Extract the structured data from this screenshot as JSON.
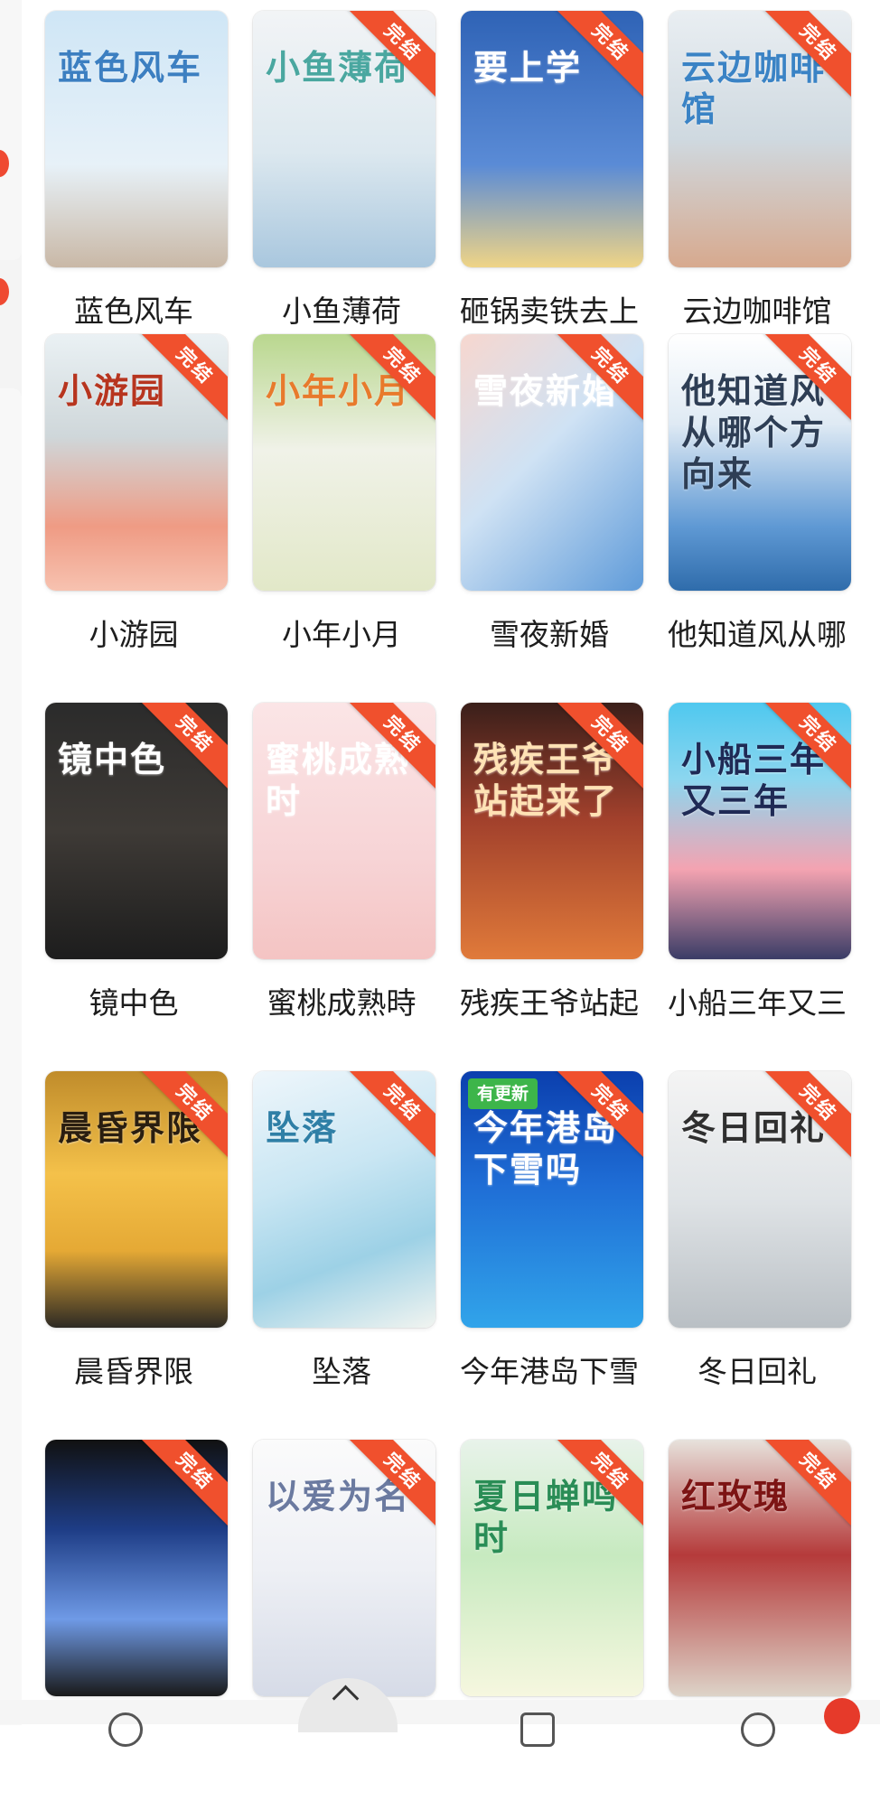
{
  "ribbon_label": "完结",
  "update_label": "有更新",
  "colors": {
    "ribbon": "#f0502d",
    "update_badge": "#3db54a",
    "badge_dot": "#e63a2a"
  },
  "books": [
    {
      "title": "蓝色风车",
      "cover_text": "蓝色风车",
      "bg": "linear-gradient(180deg,#cfe6f6 0%,#e7f1f8 60%,#c9b8a6 100%)",
      "fg": "#3c7fc1",
      "ribbon": false,
      "update": false
    },
    {
      "title": "小鱼薄荷",
      "cover_text": "小鱼薄荷",
      "bg": "linear-gradient(180deg,#f2f4f6 0%,#dce8ef 55%,#a9c7de 100%)",
      "fg": "#4aa7a0",
      "ribbon": true,
      "update": false
    },
    {
      "title": "砸锅卖铁去上",
      "cover_text": "要上学",
      "bg": "linear-gradient(180deg,#2f63b6 0%,#5a8bd6 60%,#efd486 100%)",
      "fg": "#ffffff",
      "ribbon": true,
      "update": false
    },
    {
      "title": "云边咖啡馆",
      "cover_text": "云边咖啡馆",
      "bg": "linear-gradient(180deg,#e9eef2 0%,#cfd9e0 50%,#d7a98e 100%)",
      "fg": "#3a83c5",
      "ribbon": true,
      "update": false
    },
    {
      "title": "小游园",
      "cover_text": "小游园",
      "bg": "linear-gradient(180deg,#eaf1f4 0%,#cfd7da 40%,#ef9b84 75%,#f7c2b0 100%)",
      "fg": "#b7351f",
      "ribbon": true,
      "update": false
    },
    {
      "title": "小年小月",
      "cover_text": "小年小月",
      "bg": "linear-gradient(180deg,#b9d78e 0%,#f0f2e8 45%,#e2e8c8 100%)",
      "fg": "#e87a2c",
      "ribbon": true,
      "update": false
    },
    {
      "title": "雪夜新婚",
      "cover_text": "雪夜新婚",
      "bg": "linear-gradient(135deg,#f7d7cf 0%,#cfe2f4 45%,#5f9bd9 100%)",
      "fg": "#ffffff",
      "ribbon": true,
      "update": false
    },
    {
      "title": "他知道风从哪",
      "cover_text": "他知道风从哪个方向来",
      "bg": "linear-gradient(180deg,#ffffff 0%,#dfeaf4 35%,#5f99d4 75%,#2f6cab 100%)",
      "fg": "#2e3e55",
      "ribbon": true,
      "update": false
    },
    {
      "title": "镜中色",
      "cover_text": "镜中色",
      "bg": "linear-gradient(180deg,#2b2b2b 0%,#3e3a36 50%,#1d1d1d 100%)",
      "fg": "#ffffff",
      "ribbon": true,
      "update": false
    },
    {
      "title": "蜜桃成熟時",
      "cover_text": "蜜桃成熟时",
      "bg": "linear-gradient(180deg,#fbe5e6 0%,#f7d4d6 60%,#f4c4c3 100%)",
      "fg": "#ffffff",
      "ribbon": true,
      "update": false
    },
    {
      "title": "残疾王爷站起",
      "cover_text": "残疾王爷站起来了",
      "bg": "linear-gradient(180deg,#3a1f1a 0%,#a1402c 45%,#e07a3a 100%)",
      "fg": "#ffe2b5",
      "ribbon": true,
      "update": false
    },
    {
      "title": "小船三年又三",
      "cover_text": "小船三年又三年",
      "bg": "linear-gradient(180deg,#4fc8ef 0%,#8cd6ef 30%,#f4a3b1 65%,#3a3c66 100%)",
      "fg": "#1f2a55",
      "ribbon": true,
      "update": false
    },
    {
      "title": "晨昏界限",
      "cover_text": "晨昏界限",
      "bg": "linear-gradient(180deg,#c08c2b 0%,#f4c14a 40%,#e5a935 70%,#2d2a24 100%)",
      "fg": "#2a1e10",
      "ribbon": true,
      "update": false
    },
    {
      "title": "坠落",
      "cover_text": "坠落",
      "bg": "linear-gradient(160deg,#eef6fb 0%,#c9e6f3 40%,#9dd1e6 70%,#f1f4f0 100%)",
      "fg": "#2f7fa6",
      "ribbon": true,
      "update": false
    },
    {
      "title": "今年港岛下雪",
      "cover_text": "今年港岛下雪吗",
      "bg": "linear-gradient(180deg,#0b3fae 0%,#1f6ed6 45%,#31a4ea 100%)",
      "fg": "#ffffff",
      "ribbon": true,
      "update": true
    },
    {
      "title": "冬日回礼",
      "cover_text": "冬日回礼",
      "bg": "linear-gradient(180deg,#f4f4f4 0%,#dfe3e6 50%,#b9bfc4 100%)",
      "fg": "#2f2f2f",
      "ribbon": true,
      "update": false
    },
    {
      "title": "",
      "cover_text": "",
      "bg": "linear-gradient(180deg,#111 0%,#1e3d86 35%,#6f9ae6 70%,#1a1a1a 100%)",
      "fg": "#ffffff",
      "ribbon": true,
      "update": false
    },
    {
      "title": "",
      "cover_text": "以爱为名",
      "bg": "linear-gradient(180deg,#fbfbfb 0%,#eef0f5 50%,#d6dbe7 100%)",
      "fg": "#6b7aa0",
      "ribbon": true,
      "update": false
    },
    {
      "title": "",
      "cover_text": "夏日蝉鸣时",
      "bg": "linear-gradient(180deg,#e8f3ea 0%,#c7eac0 45%,#f6f7df 100%)",
      "fg": "#2a8d56",
      "ribbon": true,
      "update": false
    },
    {
      "title": "",
      "cover_text": "红玫瑰",
      "bg": "linear-gradient(180deg,#e7e2dc 0%,#b53a3a 45%,#ddd3c8 100%)",
      "fg": "#7d1414",
      "ribbon": true,
      "update": false
    }
  ]
}
